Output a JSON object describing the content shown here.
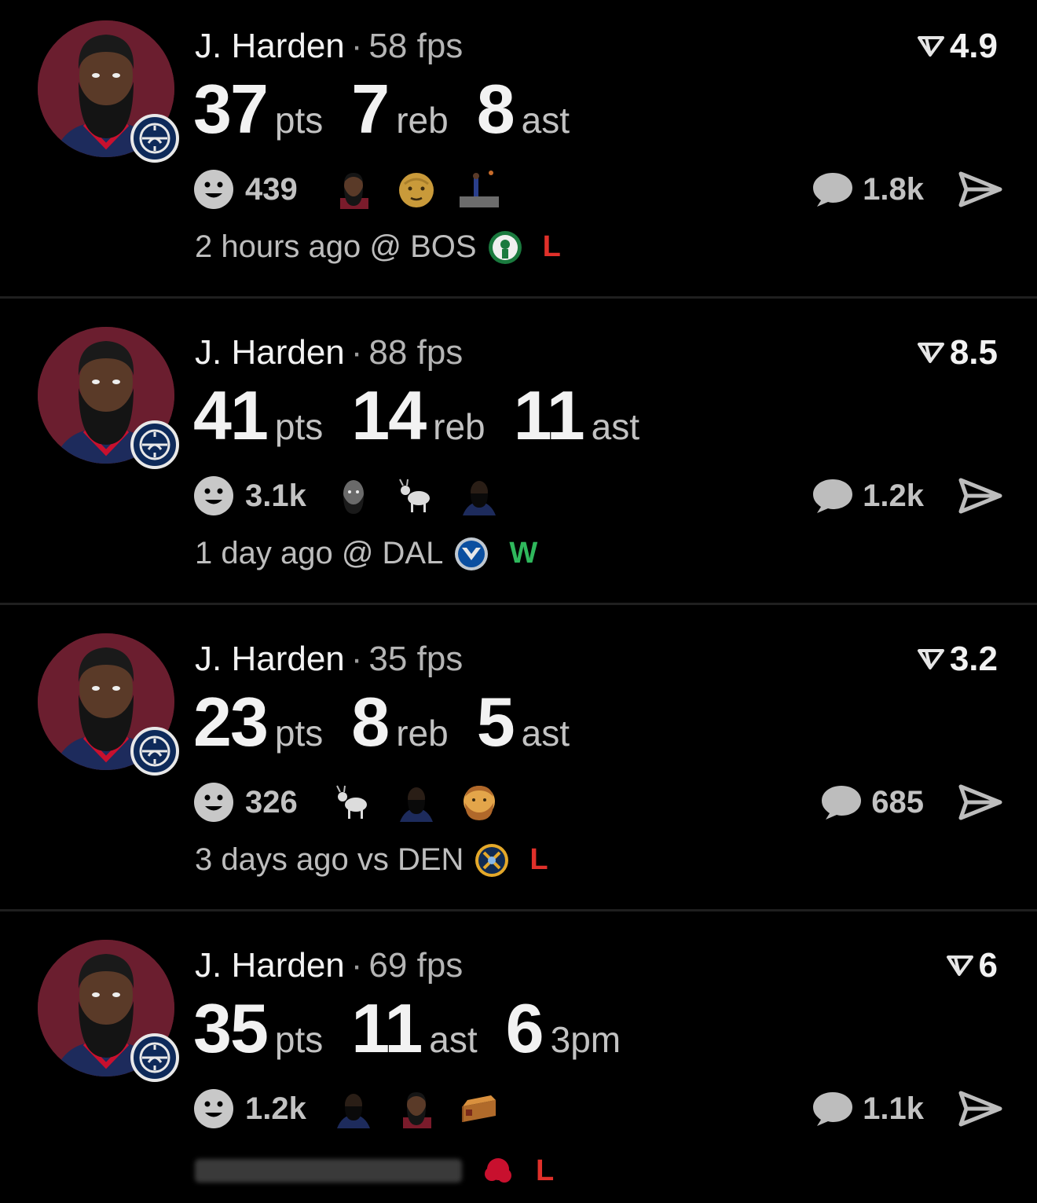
{
  "posts": [
    {
      "player_name": "J. Harden",
      "separator": "·",
      "fps": "58 fps",
      "rating": "4.9",
      "stats": [
        {
          "value": "37",
          "unit": "pts"
        },
        {
          "value": "7",
          "unit": "reb"
        },
        {
          "value": "8",
          "unit": "ast"
        }
      ],
      "reaction_count": "439",
      "reaction_emojis": [
        "harden-face",
        "old-man-face",
        "court-photo"
      ],
      "comment_count": "1.8k",
      "time_ago": "2 hours ago",
      "location": "@ BOS",
      "opponent_logo": "celtics-logo",
      "result": "L",
      "result_color": "#e0302a"
    },
    {
      "player_name": "J. Harden",
      "separator": "·",
      "fps": "88 fps",
      "rating": "8.5",
      "stats": [
        {
          "value": "41",
          "unit": "pts"
        },
        {
          "value": "14",
          "unit": "reb"
        },
        {
          "value": "11",
          "unit": "ast"
        }
      ],
      "reaction_count": "3.1k",
      "reaction_emojis": [
        "harden-face",
        "goat",
        "harden-hype"
      ],
      "comment_count": "1.2k",
      "time_ago": "1 day ago",
      "location": "@ DAL",
      "opponent_logo": "mavericks-logo",
      "result": "W",
      "result_color": "#2fb85c"
    },
    {
      "player_name": "J. Harden",
      "separator": "·",
      "fps": "35 fps",
      "rating": "3.2",
      "stats": [
        {
          "value": "23",
          "unit": "pts"
        },
        {
          "value": "8",
          "unit": "reb"
        },
        {
          "value": "5",
          "unit": "ast"
        }
      ],
      "reaction_count": "326",
      "reaction_emojis": [
        "goat",
        "harden-hype",
        "bearded-face"
      ],
      "comment_count": "685",
      "time_ago": "3 days ago",
      "location": "vs DEN",
      "opponent_logo": "nuggets-logo",
      "result": "L",
      "result_color": "#e0302a"
    },
    {
      "player_name": "J. Harden",
      "separator": "·",
      "fps": "69 fps",
      "rating": "6",
      "stats": [
        {
          "value": "35",
          "unit": "pts"
        },
        {
          "value": "11",
          "unit": "ast"
        },
        {
          "value": "6",
          "unit": "3pm"
        }
      ],
      "reaction_count": "1.2k",
      "reaction_emojis": [
        "harden-hype",
        "harden-face",
        "pie"
      ],
      "comment_count": "1.1k",
      "time_ago": "",
      "location": "",
      "opponent_logo": "red-team-logo",
      "result": "L",
      "result_color": "#e0302a"
    }
  ],
  "icons": {
    "rating": "rating-arrow-icon",
    "reactions": "smiley-icon",
    "comments": "speech-bubble-icon",
    "share": "send-icon"
  },
  "colors": {
    "background": "#000000",
    "avatar_bg": "#6b1e2f",
    "win": "#2fb85c",
    "loss": "#e0302a"
  }
}
